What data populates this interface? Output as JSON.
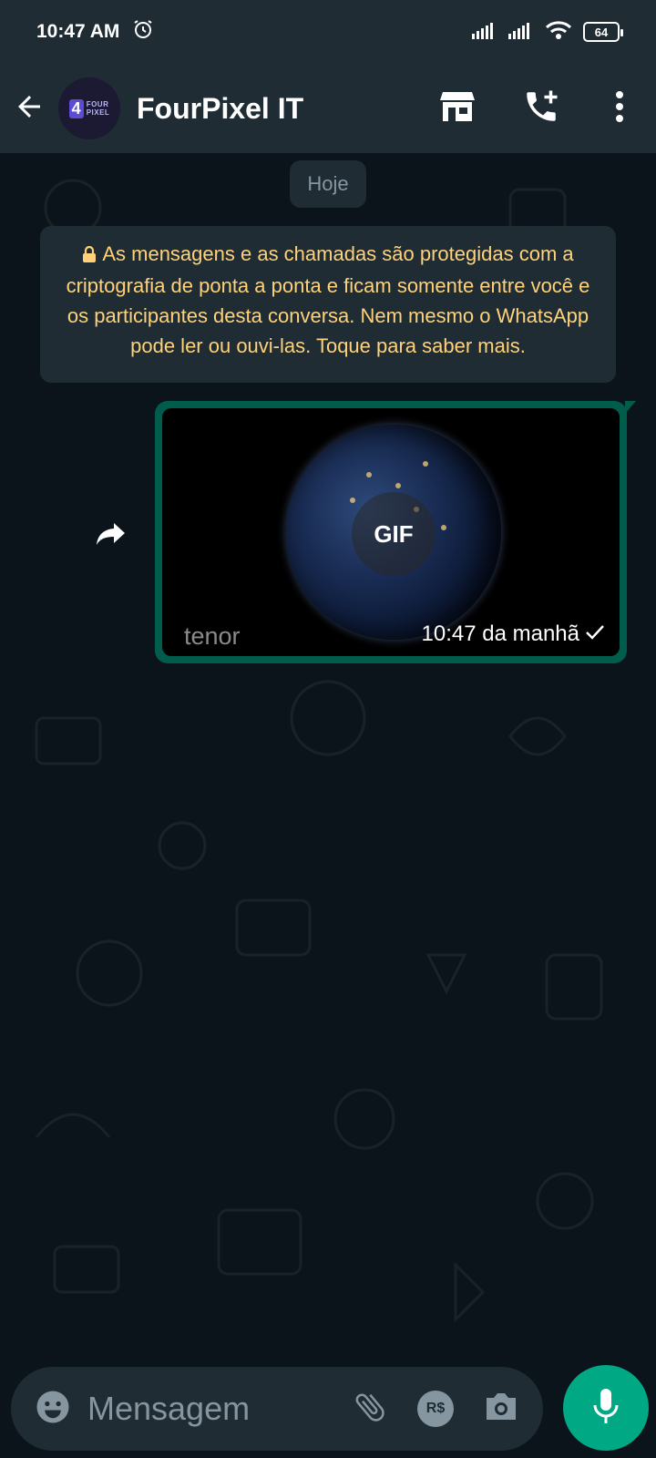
{
  "status_bar": {
    "time": "10:47 AM",
    "battery": "64",
    "icons": [
      "alarm-icon",
      "signal-icon",
      "signal-icon",
      "wifi-icon",
      "battery-icon"
    ]
  },
  "header": {
    "title": "FourPixel IT",
    "avatar": {
      "number": "4",
      "line1": "FOUR",
      "line2": "PIXEL"
    },
    "icons": [
      "back-arrow-icon",
      "store-icon",
      "add-call-icon",
      "more-vert-icon"
    ]
  },
  "chat": {
    "date_chip": "Hoje",
    "encryption_note": "As mensagens e as chamadas são protegidas com a criptografia de ponta a ponta e ficam somente entre você e os participantes desta conversa. Nem mesmo o WhatsApp pode ler ou ouvi-las. Toque para saber mais.",
    "messages": [
      {
        "type": "gif",
        "badge": "GIF",
        "source": "tenor",
        "time": "10:47 da manhã",
        "status": "sent"
      }
    ]
  },
  "input": {
    "placeholder": "Mensagem",
    "payment_label": "R$",
    "icons": [
      "emoji-icon",
      "attach-icon",
      "payment-icon",
      "camera-icon",
      "mic-icon"
    ]
  },
  "colors": {
    "header_bg": "#1f2c34",
    "chat_bg": "#0b141a",
    "bubble_out": "#005c4b",
    "accent": "#00a884",
    "note_text": "#ffd279"
  }
}
